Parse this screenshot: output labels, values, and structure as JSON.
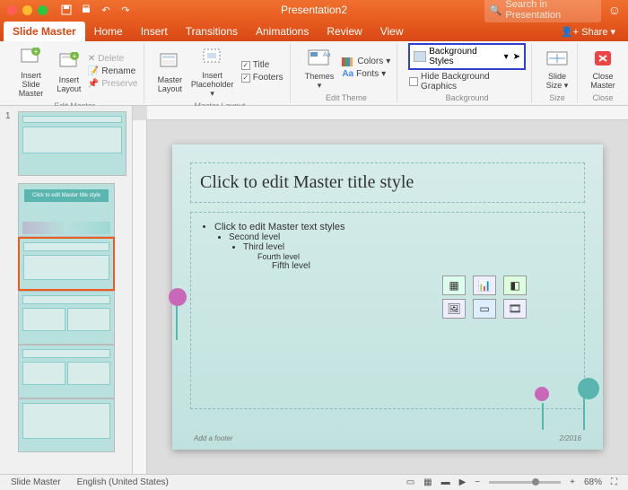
{
  "titlebar": {
    "title": "Presentation2",
    "search_placeholder": "Search in Presentation"
  },
  "tabs": {
    "slide_master": "Slide Master",
    "home": "Home",
    "insert": "Insert",
    "transitions": "Transitions",
    "animations": "Animations",
    "review": "Review",
    "view": "View",
    "share": "Share"
  },
  "ribbon": {
    "insert_slide_master": "Insert Slide\nMaster",
    "insert_layout": "Insert\nLayout",
    "delete": "Delete",
    "rename": "Rename",
    "preserve": "Preserve",
    "master_layout": "Master\nLayout",
    "insert_placeholder": "Insert\nPlaceholder",
    "title_chk": "Title",
    "footers_chk": "Footers",
    "themes": "Themes",
    "colors": "Colors",
    "fonts": "Fonts",
    "background_styles": "Background Styles",
    "hide_bg": "Hide Background Graphics",
    "slide_size": "Slide\nSize",
    "close_master": "Close\nMaster",
    "groups": {
      "edit_master": "Edit Master",
      "master_layout": "Master Layout",
      "edit_theme": "Edit Theme",
      "background": "Background",
      "size": "Size",
      "close": "Close"
    }
  },
  "thumbs": {
    "num1": "1",
    "title_text": "Click to edit Master title style"
  },
  "slide": {
    "title": "Click to edit Master title style",
    "l1": "Click to edit Master text styles",
    "l2": "Second level",
    "l3": "Third level",
    "l4": "Fourth level",
    "l5": "Fifth level",
    "footer_left": "Add a footer",
    "footer_right": "2/2016"
  },
  "status": {
    "view": "Slide Master",
    "lang": "English (United States)",
    "zoom": "68%"
  }
}
